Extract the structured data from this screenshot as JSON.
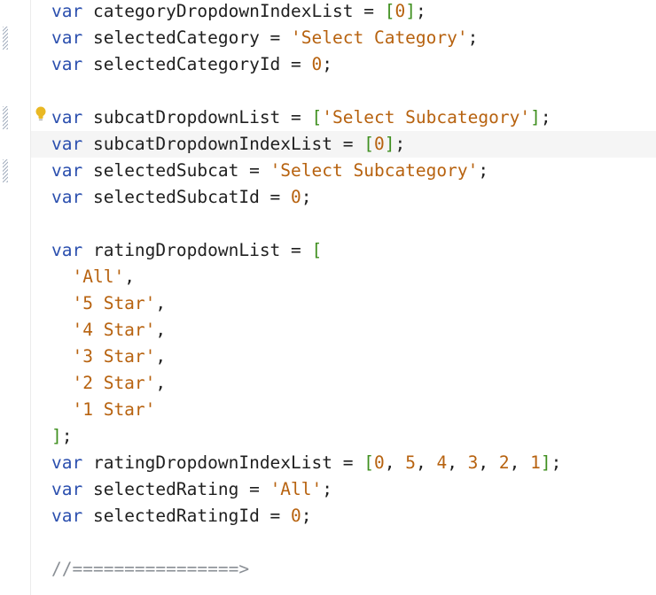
{
  "editor": {
    "lines": [
      {
        "indent": "",
        "tokens": [
          {
            "t": "var",
            "c": "kw"
          },
          {
            "t": " categoryDropdownIndexList = ",
            "c": "punc"
          },
          {
            "t": "[",
            "c": "arr"
          },
          {
            "t": "0",
            "c": "num"
          },
          {
            "t": "]",
            "c": "arr"
          },
          {
            "t": ";",
            "c": "punc"
          }
        ]
      },
      {
        "indent": "",
        "tokens": [
          {
            "t": "var",
            "c": "kw"
          },
          {
            "t": " selectedCategory = ",
            "c": "punc"
          },
          {
            "t": "'Select Category'",
            "c": "str"
          },
          {
            "t": ";",
            "c": "punc"
          }
        ]
      },
      {
        "indent": "",
        "tokens": [
          {
            "t": "var",
            "c": "kw"
          },
          {
            "t": " selectedCategoryId = ",
            "c": "punc"
          },
          {
            "t": "0",
            "c": "num"
          },
          {
            "t": ";",
            "c": "punc"
          }
        ]
      },
      {
        "indent": "",
        "tokens": []
      },
      {
        "indent": "",
        "tokens": [
          {
            "t": "var",
            "c": "kw"
          },
          {
            "t": " subcatDropdownList = ",
            "c": "punc"
          },
          {
            "t": "[",
            "c": "arr"
          },
          {
            "t": "'Select Subcategory'",
            "c": "str"
          },
          {
            "t": "]",
            "c": "arr"
          },
          {
            "t": ";",
            "c": "punc"
          }
        ]
      },
      {
        "indent": "",
        "current": true,
        "tokens": [
          {
            "t": "var",
            "c": "kw"
          },
          {
            "t": " subcatDropdownIndexList = ",
            "c": "punc"
          },
          {
            "t": "[",
            "c": "arr"
          },
          {
            "t": "0",
            "c": "num"
          },
          {
            "t": "]",
            "c": "arr"
          },
          {
            "t": ";",
            "c": "punc"
          }
        ]
      },
      {
        "indent": "",
        "tokens": [
          {
            "t": "var",
            "c": "kw"
          },
          {
            "t": " selectedSubcat = ",
            "c": "punc"
          },
          {
            "t": "'Select Subcategory'",
            "c": "str"
          },
          {
            "t": ";",
            "c": "punc"
          }
        ]
      },
      {
        "indent": "",
        "tokens": [
          {
            "t": "var",
            "c": "kw"
          },
          {
            "t": " selectedSubcatId = ",
            "c": "punc"
          },
          {
            "t": "0",
            "c": "num"
          },
          {
            "t": ";",
            "c": "punc"
          }
        ]
      },
      {
        "indent": "",
        "tokens": []
      },
      {
        "indent": "",
        "tokens": [
          {
            "t": "var",
            "c": "kw"
          },
          {
            "t": " ratingDropdownList = ",
            "c": "punc"
          },
          {
            "t": "[",
            "c": "arr"
          }
        ]
      },
      {
        "indent": "  ",
        "tokens": [
          {
            "t": "'All'",
            "c": "str"
          },
          {
            "t": ",",
            "c": "punc"
          }
        ]
      },
      {
        "indent": "  ",
        "tokens": [
          {
            "t": "'5 Star'",
            "c": "str"
          },
          {
            "t": ",",
            "c": "punc"
          }
        ]
      },
      {
        "indent": "  ",
        "tokens": [
          {
            "t": "'4 Star'",
            "c": "str"
          },
          {
            "t": ",",
            "c": "punc"
          }
        ]
      },
      {
        "indent": "  ",
        "tokens": [
          {
            "t": "'3 Star'",
            "c": "str"
          },
          {
            "t": ",",
            "c": "punc"
          }
        ]
      },
      {
        "indent": "  ",
        "tokens": [
          {
            "t": "'2 Star'",
            "c": "str"
          },
          {
            "t": ",",
            "c": "punc"
          }
        ]
      },
      {
        "indent": "  ",
        "tokens": [
          {
            "t": "'1 Star'",
            "c": "str"
          }
        ]
      },
      {
        "indent": "",
        "tokens": [
          {
            "t": "]",
            "c": "arr"
          },
          {
            "t": ";",
            "c": "punc"
          }
        ]
      },
      {
        "indent": "",
        "tokens": [
          {
            "t": "var",
            "c": "kw"
          },
          {
            "t": " ratingDropdownIndexList = ",
            "c": "punc"
          },
          {
            "t": "[",
            "c": "arr"
          },
          {
            "t": "0",
            "c": "num"
          },
          {
            "t": ", ",
            "c": "punc"
          },
          {
            "t": "5",
            "c": "num"
          },
          {
            "t": ", ",
            "c": "punc"
          },
          {
            "t": "4",
            "c": "num"
          },
          {
            "t": ", ",
            "c": "punc"
          },
          {
            "t": "3",
            "c": "num"
          },
          {
            "t": ", ",
            "c": "punc"
          },
          {
            "t": "2",
            "c": "num"
          },
          {
            "t": ", ",
            "c": "punc"
          },
          {
            "t": "1",
            "c": "num"
          },
          {
            "t": "]",
            "c": "arr"
          },
          {
            "t": ";",
            "c": "punc"
          }
        ]
      },
      {
        "indent": "",
        "tokens": [
          {
            "t": "var",
            "c": "kw"
          },
          {
            "t": " selectedRating = ",
            "c": "punc"
          },
          {
            "t": "'All'",
            "c": "str"
          },
          {
            "t": ";",
            "c": "punc"
          }
        ]
      },
      {
        "indent": "",
        "tokens": [
          {
            "t": "var",
            "c": "kw"
          },
          {
            "t": " selectedRatingId = ",
            "c": "punc"
          },
          {
            "t": "0",
            "c": "num"
          },
          {
            "t": ";",
            "c": "punc"
          }
        ]
      },
      {
        "indent": "",
        "tokens": []
      },
      {
        "indent": "",
        "tokens": [
          {
            "t": "//================>",
            "c": "cmt"
          }
        ]
      }
    ]
  },
  "gutter": {
    "change_marker_lines": [
      1,
      4,
      6
    ],
    "hint_icon_line": 4,
    "hint_icon": "lightbulb-icon"
  },
  "colors": {
    "keyword": "#2b4fae",
    "string": "#b7620f",
    "number": "#b7620f",
    "bracket": "#3f8f1f",
    "comment": "#8a8f95",
    "current_line": "#f5f5f5",
    "hint_icon": "#e9b824"
  }
}
